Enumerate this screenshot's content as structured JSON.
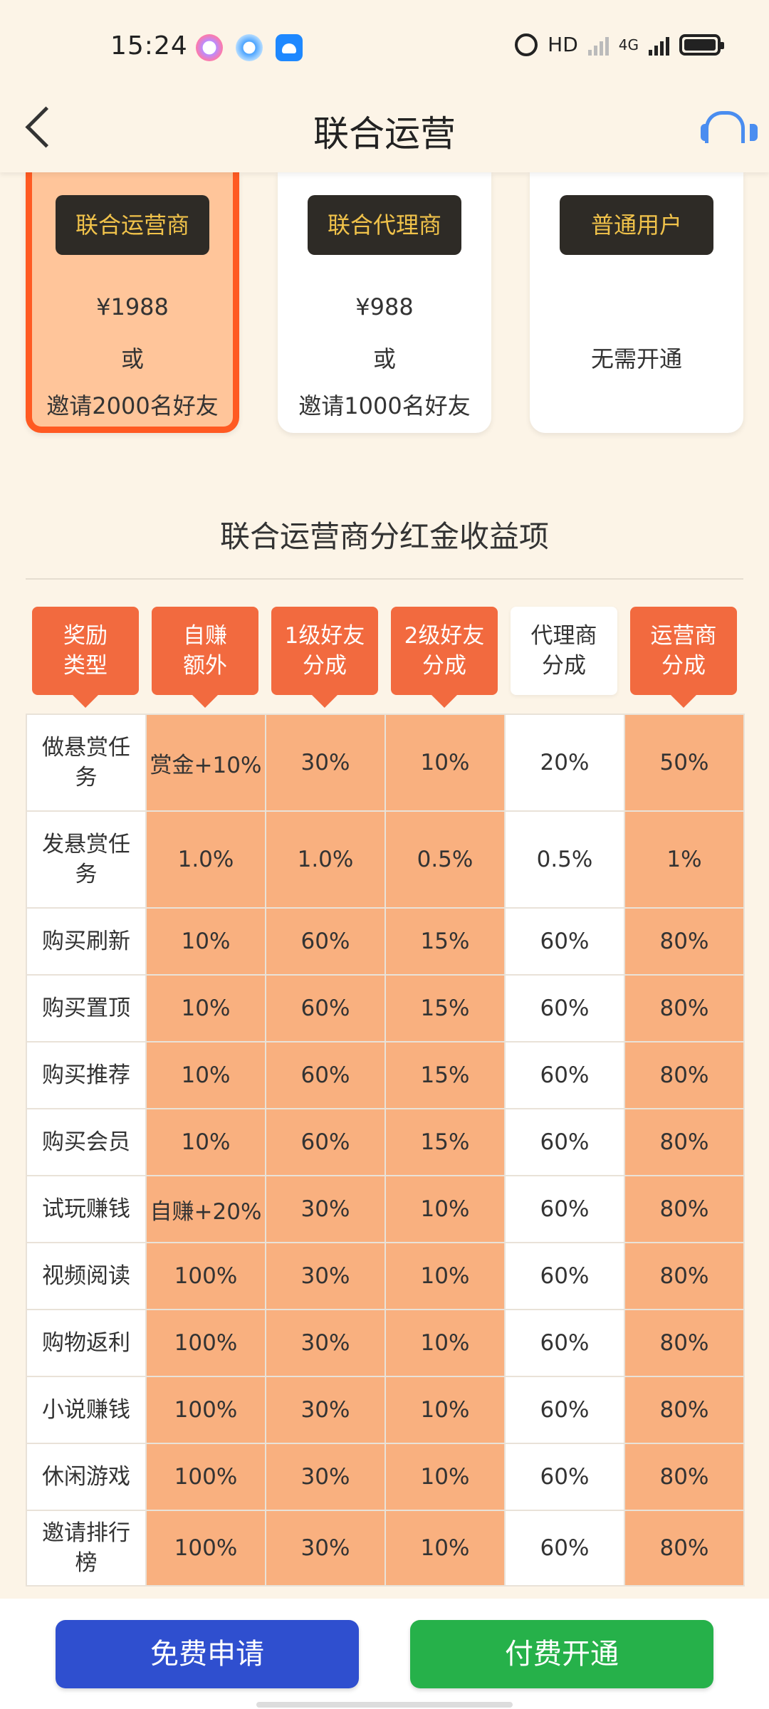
{
  "status_bar": {
    "time": "15:24",
    "app_icons": [
      "chat-app-icon",
      "browser-app-icon",
      "android-app-icon"
    ],
    "network": "HD",
    "net_type": "4G"
  },
  "header": {
    "title": "联合运营"
  },
  "plans": [
    {
      "badge": "联合运营商",
      "price": "¥1988",
      "or": "或",
      "invite": "邀请2000名好友",
      "selected": true
    },
    {
      "badge": "联合代理商",
      "price": "¥988",
      "or": "或",
      "invite": "邀请1000名好友",
      "selected": false
    },
    {
      "badge": "普通用户",
      "note": "无需开通",
      "selected": false
    }
  ],
  "section": {
    "title": "联合运营商分红金收益项"
  },
  "columns": [
    {
      "line1": "奖励",
      "line2": "类型"
    },
    {
      "line1": "自赚",
      "line2": "额外"
    },
    {
      "line1": "1级好友",
      "line2": "分成"
    },
    {
      "line1": "2级好友",
      "line2": "分成"
    },
    {
      "line1": "代理商",
      "line2": "分成"
    },
    {
      "line1": "运营商",
      "line2": "分成"
    }
  ],
  "rows": [
    {
      "label": "做悬赏任务",
      "cells": [
        "赏金+10%",
        "30%",
        "10%",
        "20%",
        "50%"
      ]
    },
    {
      "label": "发悬赏任务",
      "cells": [
        "1.0%",
        "1.0%",
        "0.5%",
        "0.5%",
        "1%"
      ]
    },
    {
      "label": "购买刷新",
      "cells": [
        "10%",
        "60%",
        "15%",
        "60%",
        "80%"
      ]
    },
    {
      "label": "购买置顶",
      "cells": [
        "10%",
        "60%",
        "15%",
        "60%",
        "80%"
      ]
    },
    {
      "label": "购买推荐",
      "cells": [
        "10%",
        "60%",
        "15%",
        "60%",
        "80%"
      ]
    },
    {
      "label": "购买会员",
      "cells": [
        "10%",
        "60%",
        "15%",
        "60%",
        "80%"
      ]
    },
    {
      "label": "试玩赚钱",
      "cells": [
        "自赚+20%",
        "30%",
        "10%",
        "60%",
        "80%"
      ]
    },
    {
      "label": "视频阅读",
      "cells": [
        "100%",
        "30%",
        "10%",
        "60%",
        "80%"
      ]
    },
    {
      "label": "购物返利",
      "cells": [
        "100%",
        "30%",
        "10%",
        "60%",
        "80%"
      ]
    },
    {
      "label": "小说赚钱",
      "cells": [
        "100%",
        "30%",
        "10%",
        "60%",
        "80%"
      ]
    },
    {
      "label": "休闲游戏",
      "cells": [
        "100%",
        "30%",
        "10%",
        "60%",
        "80%"
      ]
    },
    {
      "label": "邀请排行榜",
      "cells": [
        "100%",
        "30%",
        "10%",
        "60%",
        "80%"
      ]
    }
  ],
  "actions": {
    "apply_label": "免费申请",
    "pay_label": "付费开通"
  },
  "colors": {
    "accent_orange": "#f26a3f",
    "cell_orange": "#f9b07f",
    "apply_blue": "#2f4fcf",
    "pay_green": "#26b14a",
    "badge_dark": "#2e2b26",
    "badge_text": "#f0c24a"
  }
}
